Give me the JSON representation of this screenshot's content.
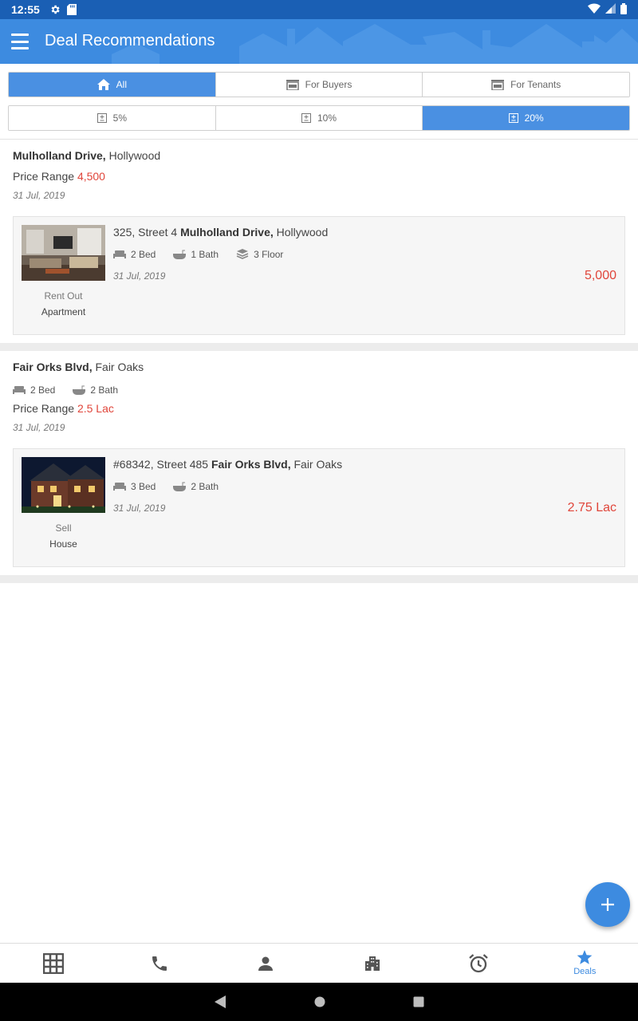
{
  "status_bar": {
    "time": "12:55"
  },
  "app_bar": {
    "title": "Deal Recommendations"
  },
  "filter_tabs": [
    {
      "label": "All",
      "active": true,
      "icon": "home-icon"
    },
    {
      "label": "For Buyers",
      "active": false,
      "icon": "sale-sign-icon"
    },
    {
      "label": "For Tenants",
      "active": false,
      "icon": "rent-sign-icon"
    }
  ],
  "percent_tabs": [
    {
      "label": "5%",
      "active": false
    },
    {
      "label": "10%",
      "active": false
    },
    {
      "label": "20%",
      "active": true
    }
  ],
  "deals": [
    {
      "location_bold": "Mulholland Drive,",
      "location_rest": " Hollywood",
      "price_label": "Price Range ",
      "price_value": "4,500",
      "date": "31 Jul, 2019",
      "features": [],
      "match": {
        "address_prefix": "325, Street 4 ",
        "address_bold": "Mulholland Drive,",
        "address_rest": " Hollywood",
        "features": [
          {
            "icon": "bed-icon",
            "label": "2 Bed"
          },
          {
            "icon": "bath-icon",
            "label": "1 Bath"
          },
          {
            "icon": "floor-icon",
            "label": "3 Floor"
          }
        ],
        "date": "31 Jul, 2019",
        "price": "5,000",
        "purpose": "Rent Out",
        "category": "Apartment"
      }
    },
    {
      "location_bold": "Fair Orks Blvd,",
      "location_rest": " Fair Oaks",
      "price_label": "Price Range ",
      "price_value": "2.5 Lac",
      "date": "31 Jul, 2019",
      "features": [
        {
          "icon": "bed-icon",
          "label": "2 Bed"
        },
        {
          "icon": "bath-icon",
          "label": "2 Bath"
        }
      ],
      "match": {
        "address_prefix": "#68342, Street 485 ",
        "address_bold": "Fair Orks Blvd,",
        "address_rest": " Fair Oaks",
        "features": [
          {
            "icon": "bed-icon",
            "label": "3 Bed"
          },
          {
            "icon": "bath-icon",
            "label": "2 Bath"
          }
        ],
        "date": "31 Jul, 2019",
        "price": "2.75 Lac",
        "purpose": "Sell",
        "category": "House"
      }
    }
  ],
  "bottom_nav": [
    {
      "icon": "grid-icon",
      "label": ""
    },
    {
      "icon": "phone-icon",
      "label": ""
    },
    {
      "icon": "person-icon",
      "label": ""
    },
    {
      "icon": "building-icon",
      "label": ""
    },
    {
      "icon": "alarm-icon",
      "label": ""
    },
    {
      "icon": "star-icon",
      "label": "Deals",
      "active": true
    }
  ],
  "colors": {
    "primary": "#3d8be0",
    "status_bar": "#1a5fb4",
    "price": "#e0453a",
    "active_tab": "#4a90e2"
  }
}
